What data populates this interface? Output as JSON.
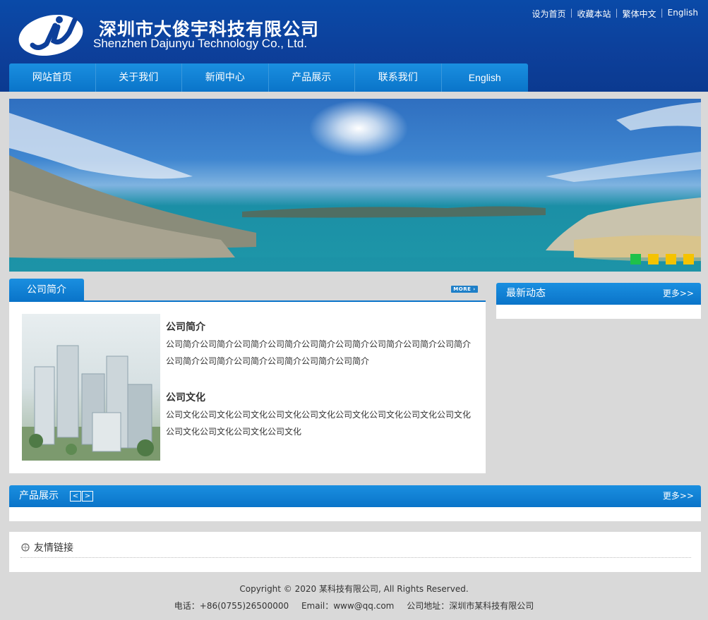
{
  "header": {
    "company_cn": "深圳市大俊宇科技有限公司",
    "company_en": "Shenzhen Dajunyu Technology Co., Ltd.",
    "top_links": [
      "设为首页",
      "收藏本站",
      "繁体中文",
      "English"
    ]
  },
  "nav": [
    "网站首页",
    "关于我们",
    "新闻中心",
    "产品展示",
    "联系我们",
    "English"
  ],
  "banner": {
    "dots": [
      "active",
      "",
      "",
      ""
    ]
  },
  "about": {
    "tab": "公司简介",
    "more": "MORE",
    "intro_title": "公司简介",
    "intro_text": "公司简介公司简介公司简介公司简介公司简介公司简介公司简介公司简介公司简介公司简介公司简介公司简介公司简介公司简介公司简介",
    "culture_title": "公司文化",
    "culture_text": "公司文化公司文化公司文化公司文化公司文化公司文化公司文化公司文化公司文化公司文化公司文化公司文化公司文化"
  },
  "news": {
    "title": "最新动态",
    "more": "更多>>"
  },
  "products": {
    "title": "产品展示",
    "prev": "<",
    "next": ">",
    "more": "更多>>"
  },
  "links": {
    "title": "友情链接"
  },
  "footer": {
    "copyright": "Copyright © 2020 某科技有限公司, All Rights Reserved.",
    "phone": "电话：+86(0755)26500000",
    "email": "Email：www@qq.com",
    "address": "公司地址：深圳市某科技有限公司"
  },
  "colors": {
    "header_bg": "#0d3f9a",
    "nav_bg": "#0a74c9",
    "dot_active": "#1fc14a",
    "dot": "#f5c300"
  }
}
